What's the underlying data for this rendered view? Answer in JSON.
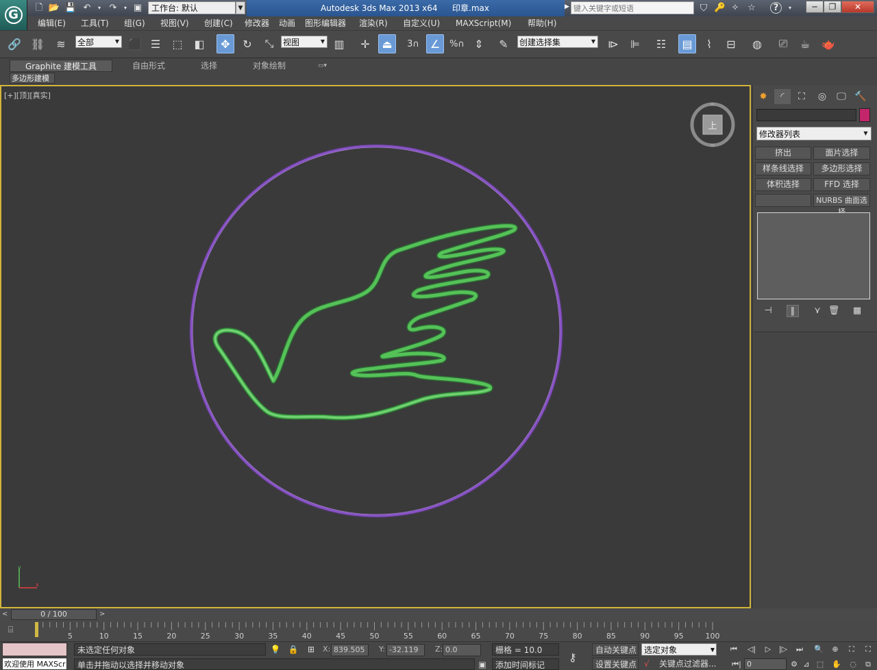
{
  "titlebar": {
    "workspace_label": "工作台: 默认",
    "app_name": "Autodesk 3ds Max  2013 x64",
    "file_name": "印章.max",
    "search_placeholder": "键入关键字或短语"
  },
  "menu": [
    "编辑(E)",
    "工具(T)",
    "组(G)",
    "视图(V)",
    "创建(C)",
    "修改器",
    "动画",
    "图形编辑器",
    "渲染(R)",
    "自定义(U)",
    "MAXScript(M)",
    "帮助(H)"
  ],
  "toolbar": {
    "selection_filter": "全部",
    "reference_coord": "视图",
    "named_selection": "创建选择集",
    "snap_label": "3",
    "angle_snap_label": "%"
  },
  "ribbon": {
    "tabs": [
      "Graphite 建模工具",
      "自由形式",
      "选择",
      "对象绘制"
    ],
    "subtab": "多边形建模"
  },
  "viewport": {
    "label": "[+][顶][真实]",
    "viewcube_face": "上",
    "ring_color": "#8a52c9",
    "shape_color": "#55c258"
  },
  "command_panel": {
    "object_color": "#c3266b",
    "modifier_list": "修改器列表",
    "modifier_buttons": [
      "挤出",
      "面片选择",
      "样条线选择",
      "多边形选择",
      "体积选择",
      "FFD 选择",
      "",
      "NURBS 曲面选择"
    ]
  },
  "timeline": {
    "frame_display": "0 / 100",
    "ticks": [
      "5",
      "10",
      "15",
      "20",
      "25",
      "30",
      "35",
      "40",
      "45",
      "50",
      "55",
      "60",
      "65",
      "70",
      "75",
      "80",
      "85",
      "90",
      "95",
      "100"
    ]
  },
  "status": {
    "maxscript_label": "欢迎使用 MAXScr",
    "selection_status": "未选定任何对象",
    "prompt": "单击并拖动以选择并移动对象",
    "x_label": "X:",
    "x_value": "839.505",
    "y_label": "Y:",
    "y_value": "-32.119",
    "z_label": "Z:",
    "z_value": "0.0",
    "grid": "栅格 = 10.0",
    "auto_key": "自动关键点",
    "set_key": "设置关键点",
    "key_mode": "选定对象",
    "key_filters": "关键点过滤器...",
    "add_time_tag": "添加时间标记",
    "current_frame": "0"
  }
}
